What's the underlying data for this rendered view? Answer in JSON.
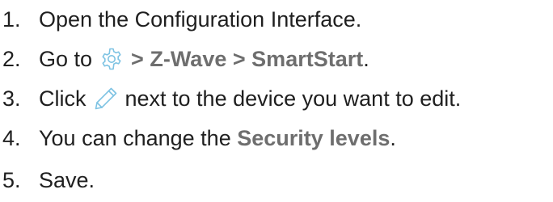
{
  "steps": [
    {
      "number": "1.",
      "text": "Open the Configuration Interface."
    },
    {
      "number": "2.",
      "prefix": "Go to",
      "sep1": ">",
      "zwave": "Z-Wave",
      "sep2": ">",
      "smartstart": "SmartStart",
      "suffix": "."
    },
    {
      "number": "3.",
      "prefix": "Click",
      "suffix": "next to the device you want to edit."
    },
    {
      "number": "4.",
      "prefix": "You can change the",
      "security": "Security levels",
      "suffix": "."
    },
    {
      "number": "5.",
      "text": "Save."
    }
  ],
  "icons": {
    "gear": "gear-icon",
    "pencil": "pencil-icon"
  },
  "colors": {
    "text": "#1f1f1f",
    "reference": "#6e6e6e",
    "icon_accent": "#7ec3e3"
  }
}
